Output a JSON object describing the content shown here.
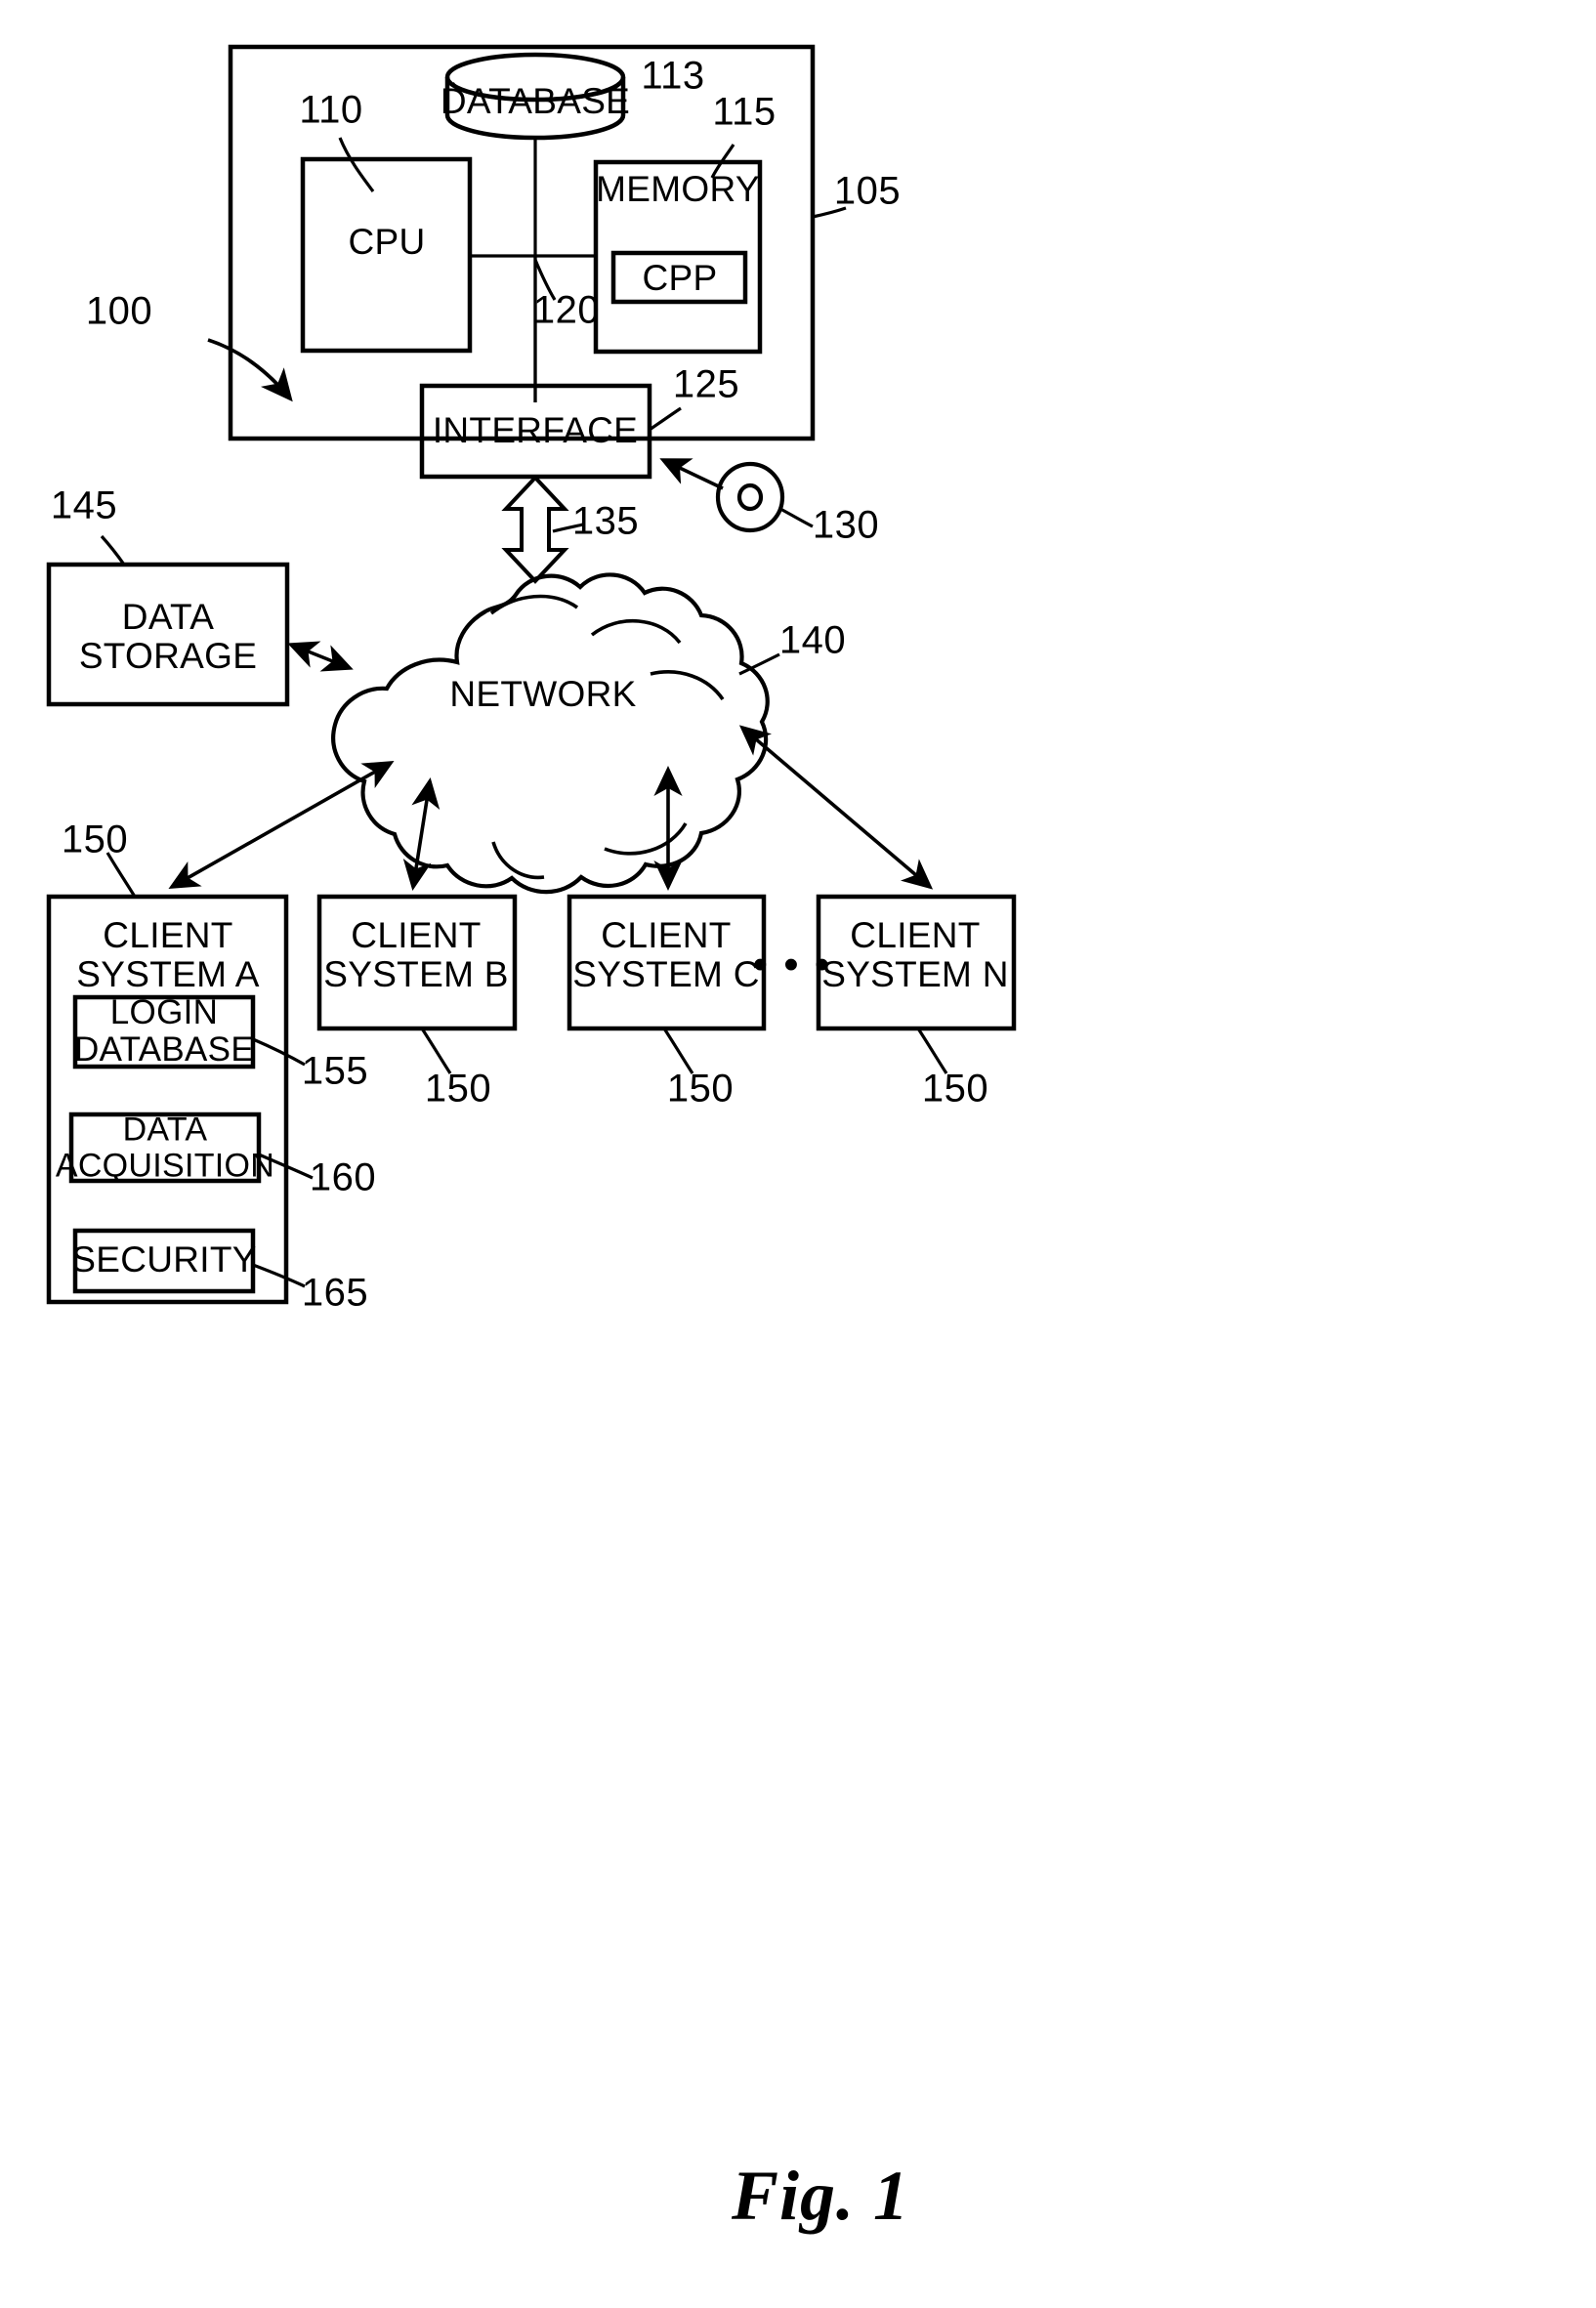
{
  "figure": {
    "caption": "Fig. 1",
    "title": "Patent diagram - networked computer system"
  },
  "blocks": {
    "server_enclosure": {
      "label": "",
      "ref": "105"
    },
    "database": {
      "label": "DATABASE",
      "ref": "113"
    },
    "cpu": {
      "label": "CPU",
      "ref": "110"
    },
    "memory": {
      "label": "MEMORY",
      "ref": "115"
    },
    "cpp": {
      "label": "CPP",
      "ref": ""
    },
    "bus": {
      "label": "",
      "ref": "120"
    },
    "interface": {
      "label": "INTERFACE",
      "ref": "125"
    },
    "media_disc": {
      "label": "",
      "ref": "130"
    },
    "io_arrow": {
      "label": "",
      "ref": "135"
    },
    "network": {
      "label": "NETWORK",
      "ref": "140"
    },
    "data_storage": {
      "label": "DATA\nSTORAGE",
      "ref": "145"
    },
    "system_overall": {
      "label": "",
      "ref": "100"
    }
  },
  "clients": [
    {
      "label": "CLIENT\nSYSTEM A",
      "ref": "150"
    },
    {
      "label": "CLIENT\nSYSTEM B",
      "ref": "150"
    },
    {
      "label": "CLIENT\nSYSTEM C",
      "ref": "150"
    },
    {
      "label": "CLIENT\nSYSTEM N",
      "ref": "150"
    }
  ],
  "client_modules": [
    {
      "label": "LOGIN\nDATABASE",
      "ref": "155"
    },
    {
      "label": "DATA\nACQUISITION",
      "ref": "160"
    },
    {
      "label": "SECURITY",
      "ref": "165"
    }
  ],
  "ellipsis": "• • •",
  "colors": {
    "stroke": "#000000",
    "background": "#ffffff"
  }
}
